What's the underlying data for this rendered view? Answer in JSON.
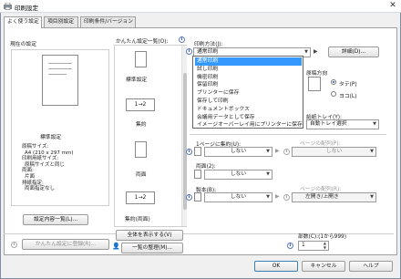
{
  "window": {
    "title": "印刷設定",
    "close": "✕"
  },
  "tabs": [
    {
      "label": "よく使う設定"
    },
    {
      "label": "項目別設定"
    },
    {
      "label": "印刷条件/バージョン"
    }
  ],
  "current_settings": {
    "heading": "現在の設定",
    "preview_title": "標準設定",
    "details": [
      "原稿サイズ:",
      "A4 (210 x 297 mm)",
      "印刷用紙サイズ:",
      "原稿サイズと同じ",
      "両面:",
      "片面",
      "排紙指定:",
      "両面指定なし"
    ],
    "list_button": "設定内容一覧(L)...",
    "register_button": "かんたん設定に登録(R)..."
  },
  "easy_settings": {
    "heading": "かんたん設定一覧(O):",
    "items": [
      {
        "label": "標準設定",
        "badge": ""
      },
      {
        "label": "集約",
        "badge": "1→2"
      },
      {
        "label": "両面",
        "badge": ""
      },
      {
        "label": "集約(両面)",
        "badge": "1→2"
      }
    ],
    "show_all_button": "全体を表示する(V)",
    "manage_button": "一覧の整理(M)..."
  },
  "print_method": {
    "label": "印刷方法(J):",
    "value": "通常印刷",
    "details_button": "詳細(D)...",
    "options": [
      "通常印刷",
      "試し印刷",
      "機密印刷",
      "保留印刷",
      "プリンターに保存",
      "保存して印刷",
      "ドキュメントボックス",
      "会議用データとして保存",
      "イメージオーバーレイ用にプリンターに保存"
    ]
  },
  "orientation": {
    "label": "原稿方向",
    "portrait": "タテ(P)",
    "landscape": "ヨコ(L)",
    "selected": "portrait"
  },
  "input_tray": {
    "label": "給紙トレイ(Y):",
    "value": "自動トレイ選択"
  },
  "combine": {
    "label": "1ページに集約(U):",
    "value": "しない",
    "order_label": "ページの配列(P):",
    "order_value": "しない"
  },
  "duplex": {
    "label": "両面(2):",
    "value": "しない"
  },
  "booklet": {
    "label": "製本(B):",
    "value": "しない",
    "order_label": "ページの配列(R):",
    "order_value": "左開き/上開き"
  },
  "copies": {
    "label": "部数(C):(1から999)",
    "value": "1"
  },
  "footer": {
    "ok": "OK",
    "cancel": "キャンセル",
    "help": "ヘルプ"
  }
}
